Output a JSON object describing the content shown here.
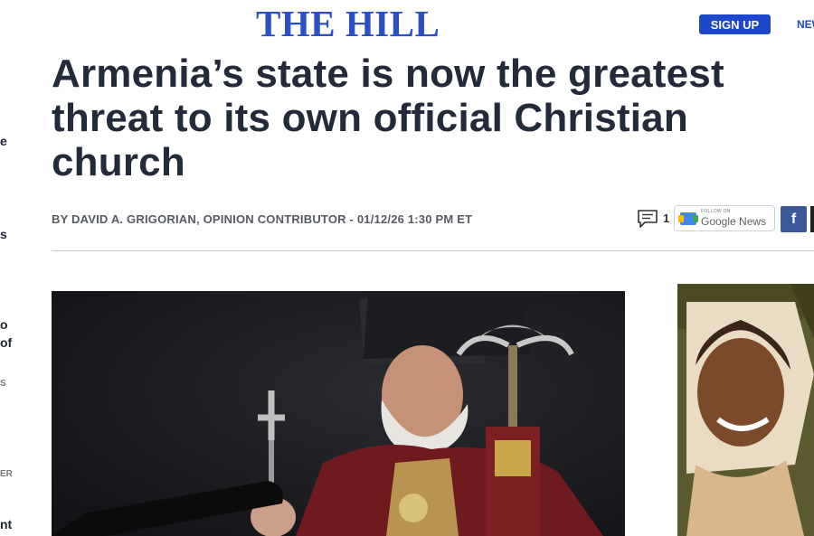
{
  "header": {
    "logo_text": "THE HILL",
    "signup_label": "SIGN UP",
    "nav_partial": "NEW"
  },
  "left_rail": {
    "fragments": [
      "e",
      "s",
      "o",
      "of",
      "S",
      "ER",
      "nt"
    ]
  },
  "article": {
    "headline": "Armenia’s state is now the greatest threat to its own official Christian church",
    "byline": "BY DAVID A. GRIGORIAN, OPINION CONTRIBUTOR - 01/12/26 1:30 PM ET",
    "comment_count": "1"
  },
  "share": {
    "google_news_small": "FOLLOW ON",
    "google_news_label": "Google News",
    "facebook_label": "f"
  },
  "colors": {
    "brand_blue": "#2b4fc7",
    "button_blue": "#1c47c9",
    "facebook": "#3b5998",
    "headline": "#232a39"
  },
  "icons": [
    "comment-icon",
    "google-news-icon",
    "facebook-icon"
  ]
}
